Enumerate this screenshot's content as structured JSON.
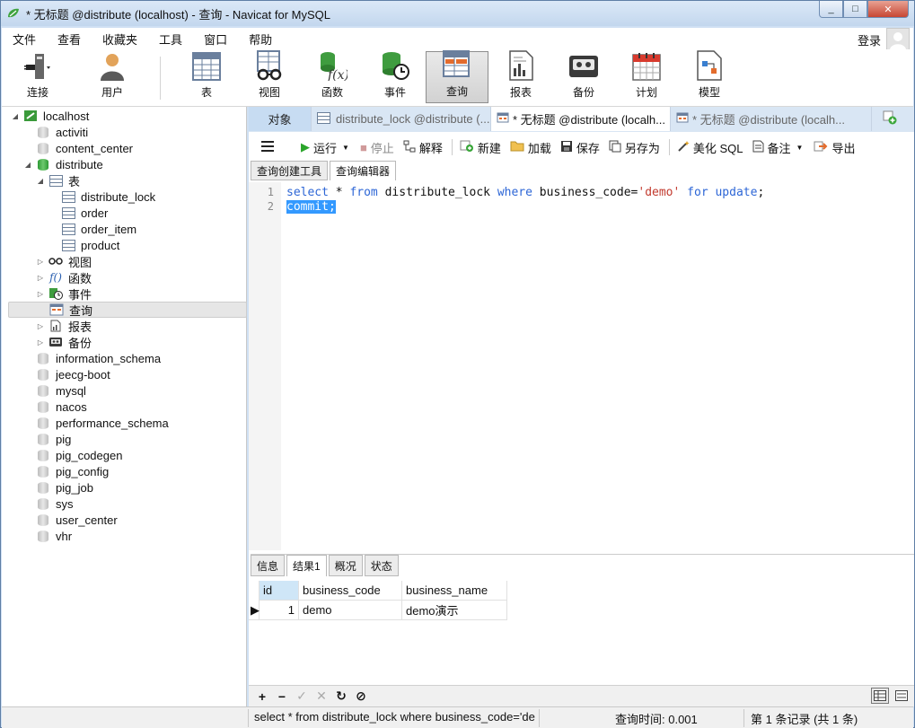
{
  "window": {
    "title": "* 无标题 @distribute (localhost) - 查询 - Navicat for MySQL",
    "min": "_",
    "max": "□",
    "close": "✕"
  },
  "menu": {
    "items": [
      "文件",
      "查看",
      "收藏夹",
      "工具",
      "窗口",
      "帮助"
    ],
    "login": "登录"
  },
  "toolbar": {
    "items": [
      {
        "label": "连接",
        "icon": "connection-icon"
      },
      {
        "label": "用户",
        "icon": "user-icon"
      },
      {
        "label": "表",
        "icon": "table-icon"
      },
      {
        "label": "视图",
        "icon": "view-icon"
      },
      {
        "label": "函数",
        "icon": "function-icon"
      },
      {
        "label": "事件",
        "icon": "event-icon"
      },
      {
        "label": "查询",
        "icon": "query-icon",
        "active": true
      },
      {
        "label": "报表",
        "icon": "report-icon"
      },
      {
        "label": "备份",
        "icon": "backup-icon"
      },
      {
        "label": "计划",
        "icon": "schedule-icon"
      },
      {
        "label": "模型",
        "icon": "model-icon"
      }
    ]
  },
  "tree": {
    "root": "localhost",
    "databases_top": [
      "activiti",
      "content_center"
    ],
    "open_db": "distribute",
    "tables_label": "表",
    "tables": [
      "distribute_lock",
      "order",
      "order_item",
      "product"
    ],
    "nodes": [
      {
        "label": "视图",
        "icon": "view-icon"
      },
      {
        "label": "函数",
        "icon": "function-icon"
      },
      {
        "label": "事件",
        "icon": "event-icon"
      },
      {
        "label": "查询",
        "icon": "query-icon"
      },
      {
        "label": "报表",
        "icon": "report-icon"
      },
      {
        "label": "备份",
        "icon": "backup-icon"
      }
    ],
    "databases_bottom": [
      "information_schema",
      "jeecg-boot",
      "mysql",
      "nacos",
      "performance_schema",
      "pig",
      "pig_codegen",
      "pig_config",
      "pig_job",
      "sys",
      "user_center",
      "vhr"
    ]
  },
  "tabs": {
    "object": "对象",
    "tab1": "distribute_lock @distribute (...",
    "tab2": "* 无标题 @distribute (localh...",
    "tab3": "* 无标题 @distribute (localh..."
  },
  "query_toolbar": {
    "run": "运行",
    "stop": "停止",
    "explain": "解释",
    "new": "新建",
    "load": "加载",
    "save": "保存",
    "save_as": "另存为",
    "beautify": "美化 SQL",
    "comment": "备注",
    "export": "导出"
  },
  "subtabs": {
    "builder": "查询创建工具",
    "editor": "查询编辑器"
  },
  "editor": {
    "line1": {
      "n": "1",
      "kw1": "select",
      "t1": " * ",
      "kw2": "from",
      "t2": " distribute_lock ",
      "kw3": "where",
      "t3": " business_code=",
      "str": "'demo'",
      "t4": " ",
      "kw4": "for",
      "t5": " ",
      "kw5": "update",
      "t6": ";"
    },
    "line2": {
      "n": "2",
      "text": "commit;"
    }
  },
  "result_tabs": {
    "info": "信息",
    "result": "结果1",
    "profile": "概况",
    "status": "状态"
  },
  "grid": {
    "columns": [
      "id",
      "business_code",
      "business_name"
    ],
    "rows": [
      [
        "1",
        "demo",
        "demo演示"
      ]
    ]
  },
  "bottom_buttons": {
    "add": "+",
    "remove": "−",
    "confirm": "✓",
    "discard": "✕",
    "refresh": "↻",
    "stop": "⊘"
  },
  "status": {
    "sql": "select * from distribute_lock where business_code='de",
    "time": "查询时间: 0.001s",
    "records": "第 1 条记录 (共 1 条)"
  }
}
